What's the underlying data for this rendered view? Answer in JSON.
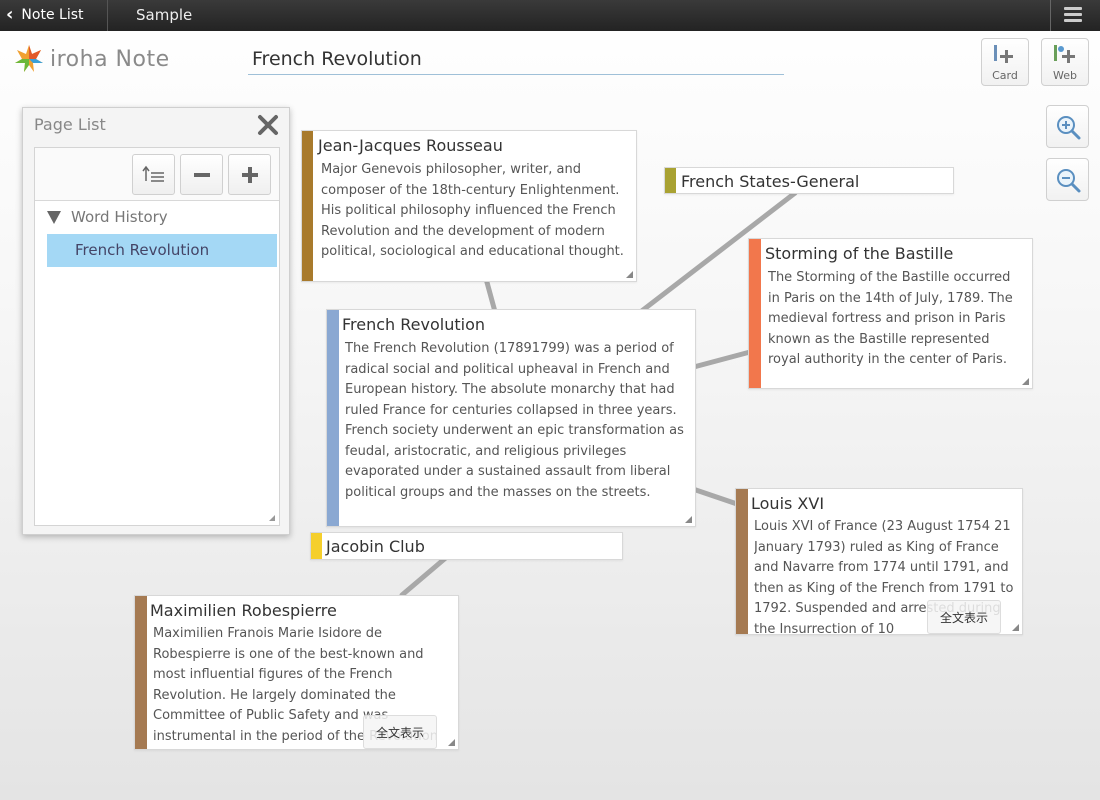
{
  "topbar": {
    "back_label": "Note List",
    "title": "Sample",
    "menu_icon": "hamburger-menu-icon"
  },
  "header": {
    "logo_text": "iroha Note",
    "title_value": "French Revolution",
    "card_button_label": "Card",
    "web_button_label": "Web"
  },
  "page_list": {
    "title": "Page List",
    "tree": {
      "root": "Word History",
      "items": [
        "French Revolution"
      ],
      "selected": "French Revolution"
    }
  },
  "cards": {
    "rousseau": {
      "title": "Jean-Jacques Rousseau",
      "body": "Major Genevois philosopher, writer, and composer of the 18th-century Enlightenment. His political philosophy influenced the French Revolution and the development of modern political, sociological and educational thought.",
      "color": "#a87a2c"
    },
    "states_general": {
      "title": "French States-General",
      "color": "#a9a232"
    },
    "bastille": {
      "title": "Storming of the Bastille",
      "body": "The Storming of the Bastille occurred in Paris on the 14th of July, 1789. The medieval fortress and prison in Paris known as the Bastille represented royal authority in the center of Paris.",
      "color": "#f2774c"
    },
    "revolution": {
      "title": "French Revolution",
      "body": "The French Revolution (17891799) was a period of radical social and political upheaval in French and European history. The absolute monarchy that had ruled France for centuries collapsed in three years. French society underwent an epic transformation as feudal, aristocratic, and religious privileges evaporated under a sustained assault from liberal political groups and the masses on the streets.",
      "color": "#8aa8d2"
    },
    "jacobin": {
      "title": "Jacobin Club",
      "color": "#f5cf2c"
    },
    "louis": {
      "title": "Louis XVI",
      "body": "Louis XVI of France (23 August 1754 21 January 1793) ruled as King of France and Navarre from 1774 until 1791, and then as King of the French from 1791 to 1792. Suspended and arrested during the Insurrection of 10",
      "fulltext_label": "全文表示",
      "color": "#a57a52"
    },
    "robespierre": {
      "title": "Maximilien Robespierre",
      "body": "Maximilien Franois Marie Isidore de Robespierre is one of the best-known and most influential figures of the French Revolution. He largely dominated the Committee of Public Safety and was instrumental in the period of the Revolution",
      "fulltext_label": "全文表示",
      "color": "#a57a52"
    }
  }
}
